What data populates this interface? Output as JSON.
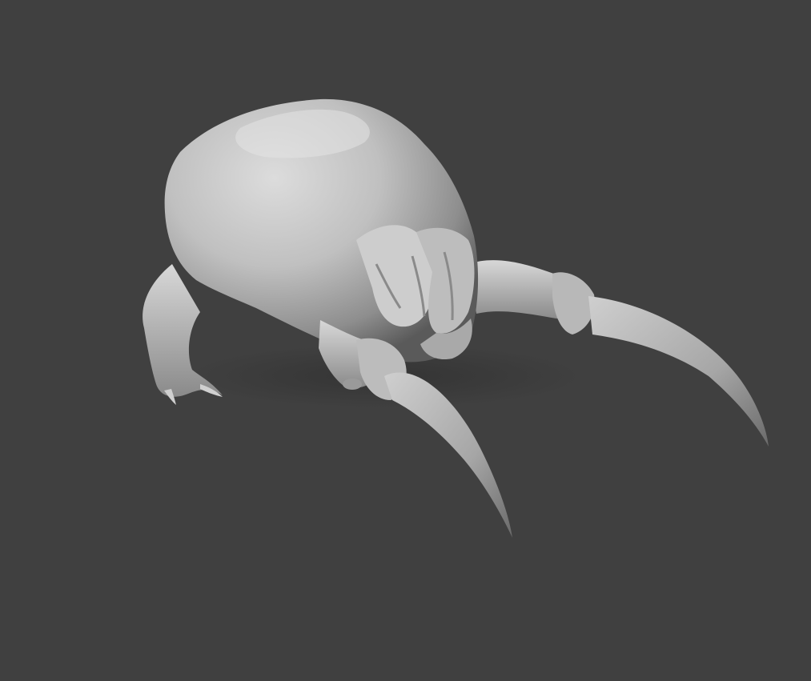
{
  "scene": {
    "background_color": "#404040",
    "model_color": "#c4c4c4",
    "subject": "grey-clay-creature-sculpt"
  }
}
